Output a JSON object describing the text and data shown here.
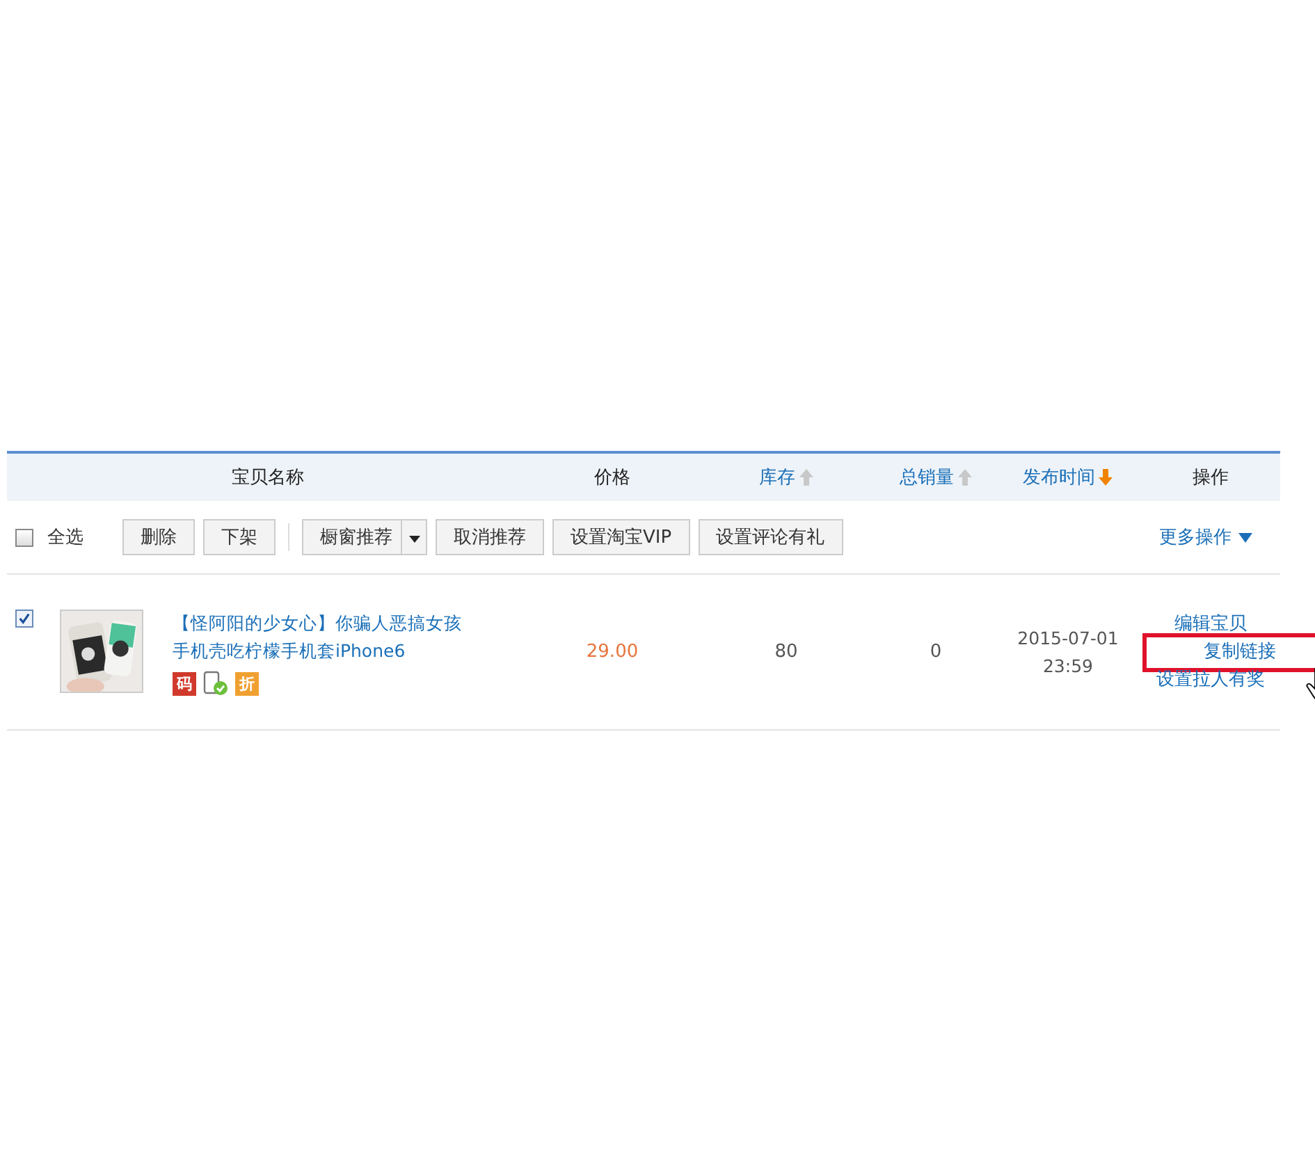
{
  "table": {
    "columns": [
      {
        "label": "宝贝名称",
        "sortable": false
      },
      {
        "label": "价格",
        "sortable": false
      },
      {
        "label": "库存",
        "sortable": true,
        "descending": false,
        "active": false
      },
      {
        "label": "总销量",
        "sortable": true,
        "descending": false,
        "active": false
      },
      {
        "label": "发布时间",
        "sortable": true,
        "descending": true,
        "active": true
      },
      {
        "label": "操作",
        "sortable": false
      }
    ],
    "toolbar": {
      "select_all": {
        "label": "全选",
        "checked": false
      },
      "buttons": [
        {
          "label": "删除",
          "kind": "plain"
        },
        {
          "label": "下架",
          "kind": "plain"
        },
        {
          "label": "橱窗推荐",
          "kind": "split"
        },
        {
          "label": "取消推荐",
          "kind": "plain"
        },
        {
          "label": "设置淘宝VIP",
          "kind": "plain"
        },
        {
          "label": "设置评论有礼",
          "kind": "plain"
        }
      ],
      "more": "更多操作"
    },
    "rows": [
      {
        "checked": true,
        "title": "【怪阿阳的少女心】你骗人恶搞女孩手机壳吃柠檬手机套iPhone6",
        "badges": [
          {
            "kind": "text",
            "label": "码",
            "color": "#d0392b"
          },
          {
            "kind": "phone"
          },
          {
            "kind": "text",
            "label": "折",
            "color": "#f0a030"
          }
        ],
        "price": "29.00",
        "stock": "80",
        "sales": "0",
        "date": "2015-07-01",
        "time": "23:59",
        "actions": [
          {
            "label": "编辑宝贝",
            "highlighted": false
          },
          {
            "label": "复制链接",
            "highlighted": true
          },
          {
            "label": "设置拉人有奖",
            "highlighted": false
          }
        ]
      }
    ]
  }
}
